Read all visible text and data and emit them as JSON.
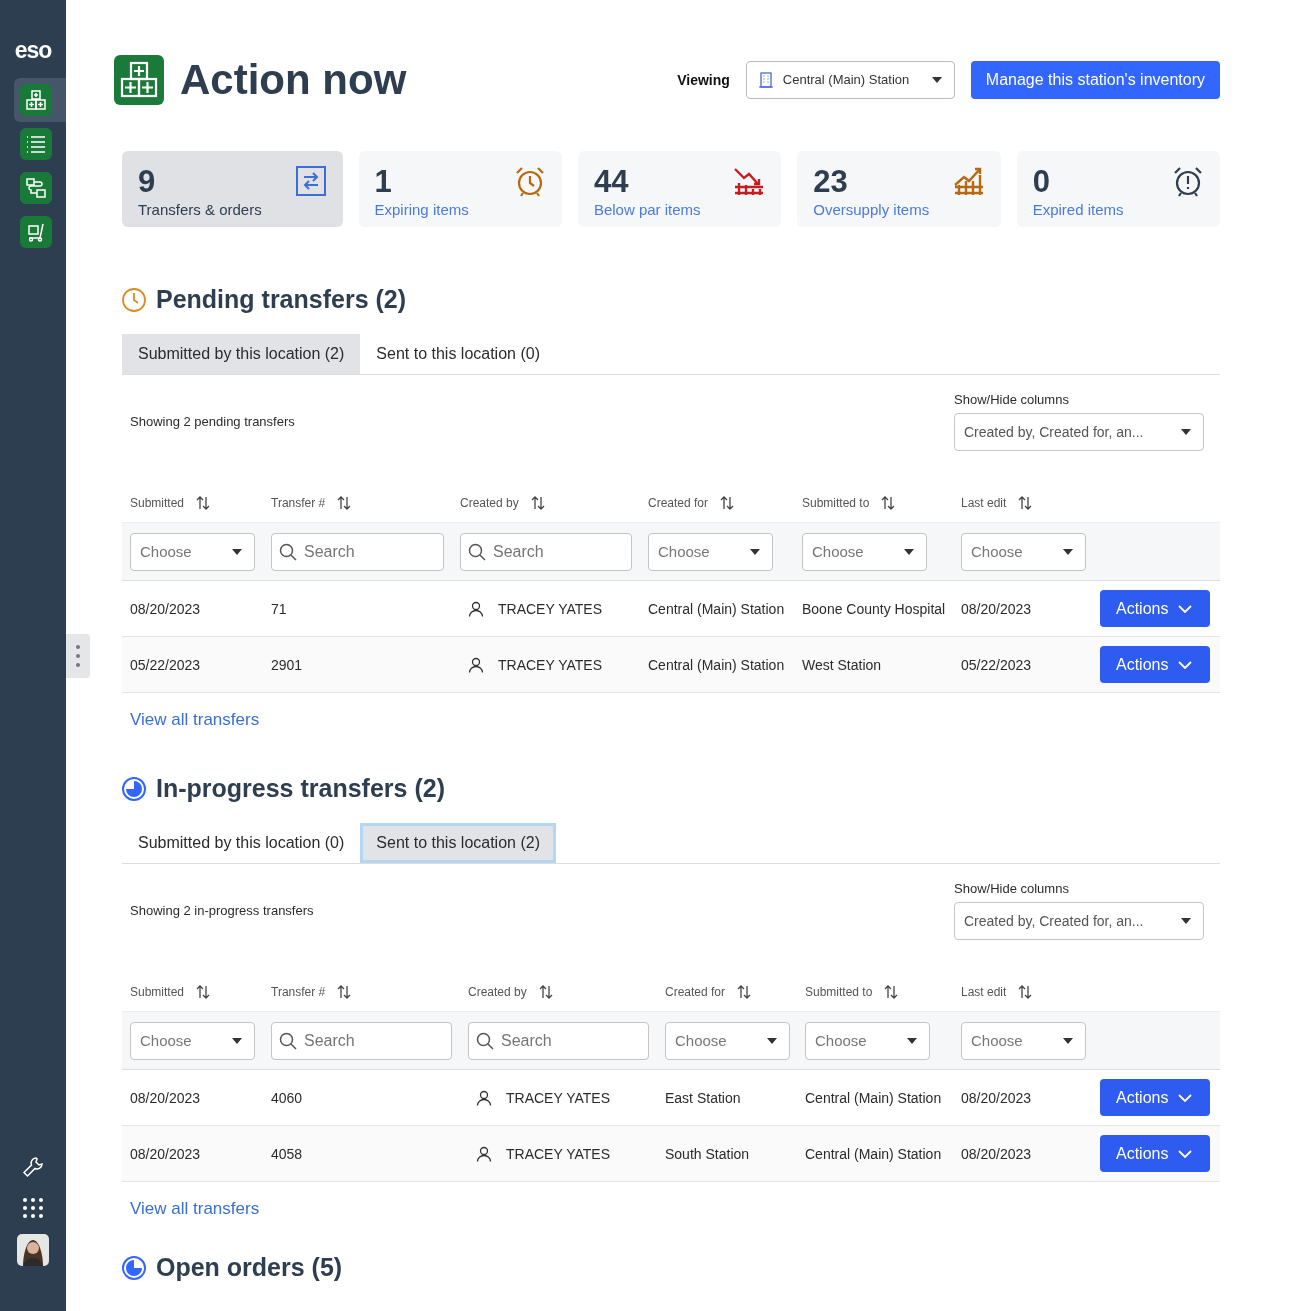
{
  "sidebar": {
    "logo": "eso",
    "items": [
      {
        "kind": "boxes",
        "selected": true
      },
      {
        "kind": "list",
        "selected": false
      },
      {
        "kind": "flow",
        "selected": false
      },
      {
        "kind": "cart",
        "selected": false
      }
    ],
    "bottom": [
      {
        "kind": "wrench"
      },
      {
        "kind": "apps"
      },
      {
        "kind": "avatar"
      }
    ]
  },
  "header": {
    "title": "Action now",
    "viewing_label": "Viewing",
    "station": "Central (Main) Station",
    "manage_button": "Manage this station's inventory"
  },
  "stats": [
    {
      "value": "9",
      "label": "Transfers & orders",
      "kind": "transfer",
      "selected": true
    },
    {
      "value": "1",
      "label": "Expiring items",
      "kind": "clock",
      "selected": false
    },
    {
      "value": "44",
      "label": "Below par items",
      "kind": "down",
      "selected": false
    },
    {
      "value": "23",
      "label": "Oversupply items",
      "kind": "up",
      "selected": false
    },
    {
      "value": "0",
      "label": "Expired items",
      "kind": "expired",
      "selected": false
    }
  ],
  "sections": [
    {
      "kind": "pending",
      "title": "Pending transfers (2)",
      "tabs": [
        {
          "label": "Submitted by this location (2)",
          "selected": true
        },
        {
          "label": "Sent to this location (0)",
          "selected": false
        }
      ],
      "showing": "Showing 2 pending transfers",
      "columns_label": "Show/Hide columns",
      "columns_value": "Created by, Created for, an...",
      "columns": [
        "Submitted",
        "Transfer #",
        "Created by",
        "Created for",
        "Submitted to",
        "Last edit"
      ],
      "filters": [
        {
          "kind": "choose",
          "placeholder": "Choose"
        },
        {
          "kind": "search",
          "placeholder": "Search"
        },
        {
          "kind": "search",
          "placeholder": "Search"
        },
        {
          "kind": "choose",
          "placeholder": "Choose"
        },
        {
          "kind": "choose",
          "placeholder": "Choose"
        },
        {
          "kind": "choose",
          "placeholder": "Choose"
        }
      ],
      "rows": [
        {
          "submitted": "08/20/2023",
          "transfer": "71",
          "created_by": "TRACEY YATES",
          "created_for": "Central (Main) Station",
          "submitted_to": "Boone County Hospital",
          "last_edit": "08/20/2023",
          "action": "Actions"
        },
        {
          "submitted": "05/22/2023",
          "transfer": "2901",
          "created_by": "TRACEY YATES",
          "created_for": "Central (Main) Station",
          "submitted_to": "West Station",
          "last_edit": "05/22/2023",
          "action": "Actions"
        }
      ],
      "link": "View all transfers"
    },
    {
      "kind": "progress",
      "title": "In-progress transfers (2)",
      "tabs": [
        {
          "label": "Submitted by this location (0)",
          "selected": false
        },
        {
          "label": "Sent to this location (2)",
          "selected": true
        }
      ],
      "showing": "Showing 2 in-progress transfers",
      "columns_label": "Show/Hide columns",
      "columns_value": "Created by, Created for, an...",
      "columns": [
        "Submitted",
        "Transfer #",
        "Created by",
        "Created for",
        "Submitted to",
        "Last edit"
      ],
      "filters": [
        {
          "kind": "choose",
          "placeholder": "Choose"
        },
        {
          "kind": "search",
          "placeholder": "Search"
        },
        {
          "kind": "search",
          "placeholder": "Search"
        },
        {
          "kind": "choose",
          "placeholder": "Choose"
        },
        {
          "kind": "choose",
          "placeholder": "Choose"
        },
        {
          "kind": "choose",
          "placeholder": "Choose"
        }
      ],
      "rows": [
        {
          "submitted": "08/20/2023",
          "transfer": "4060",
          "created_by": "TRACEY YATES",
          "created_for": "East Station",
          "submitted_to": "Central (Main) Station",
          "last_edit": "08/20/2023",
          "action": "Actions"
        },
        {
          "submitted": "08/20/2023",
          "transfer": "4058",
          "created_by": "TRACEY YATES",
          "created_for": "South Station",
          "submitted_to": "Central (Main) Station",
          "last_edit": "08/20/2023",
          "action": "Actions"
        }
      ],
      "link": "View all transfers"
    },
    {
      "kind": "orders",
      "title": "Open orders (5)"
    }
  ]
}
